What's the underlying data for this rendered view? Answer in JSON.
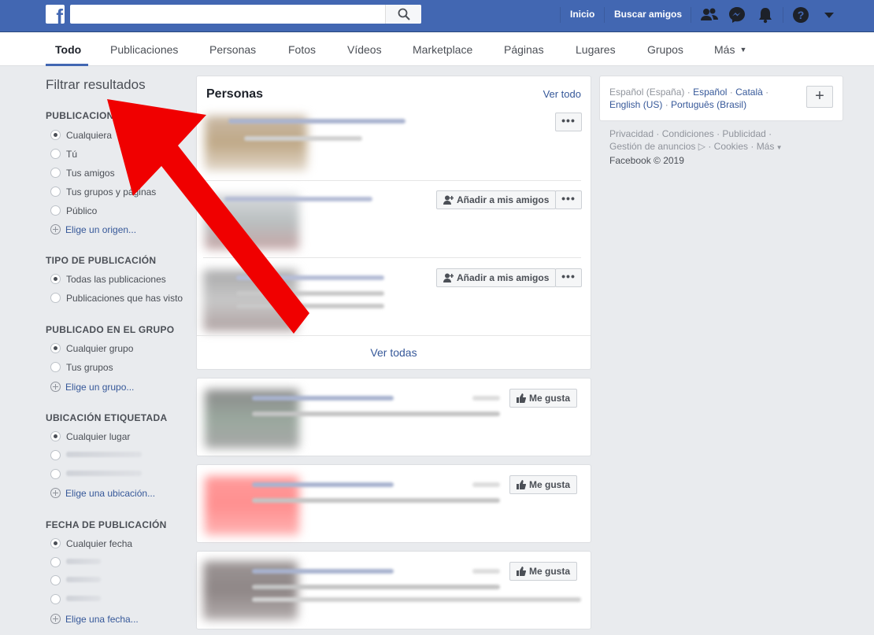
{
  "topbar": {
    "logo": "f",
    "search_placeholder": "",
    "nav": {
      "home": "Inicio",
      "find_friends": "Buscar amigos"
    }
  },
  "tabs": [
    "Todo",
    "Publicaciones",
    "Personas",
    "Fotos",
    "Vídeos",
    "Marketplace",
    "Páginas",
    "Lugares",
    "Grupos",
    "Más"
  ],
  "sidebar": {
    "title": "Filtrar resultados",
    "sections": [
      {
        "title": "PUBLICACIONES DE",
        "options": [
          "Cualquiera",
          "Tú",
          "Tus amigos",
          "Tus grupos y páginas",
          "Público"
        ],
        "add": "Elige un origen..."
      },
      {
        "title": "TIPO DE PUBLICACIÓN",
        "options": [
          "Todas las publicaciones",
          "Publicaciones que has visto"
        ]
      },
      {
        "title": "PUBLICADO EN EL GRUPO",
        "options": [
          "Cualquier grupo",
          "Tus grupos"
        ],
        "add": "Elige un grupo..."
      },
      {
        "title": "UBICACIÓN ETIQUETADA",
        "options": [
          "Cualquier lugar"
        ],
        "add": "Elige una ubicación..."
      },
      {
        "title": "FECHA DE PUBLICACIÓN",
        "options": [
          "Cualquier fecha"
        ],
        "add": "Elige una fecha..."
      }
    ]
  },
  "people_card": {
    "title": "Personas",
    "see_all_link": "Ver todo",
    "add_friend": "Añadir a mis amigos",
    "more": "•••",
    "footer_link": "Ver todas"
  },
  "pages": {
    "like": "Me gusta"
  },
  "right": {
    "languages": {
      "current": "Español (España)",
      "links": [
        "Español",
        "Català",
        "English (US)",
        "Português (Brasil)"
      ]
    },
    "add": "+",
    "footer": {
      "links": [
        "Privacidad",
        "Condiciones",
        "Publicidad",
        "Gestión de anuncios",
        "Cookies",
        "Más"
      ],
      "copyright": "Facebook © 2019"
    }
  },
  "colors": {
    "brand": "#4267b2",
    "link": "#365899",
    "arrow": "#f00000"
  }
}
